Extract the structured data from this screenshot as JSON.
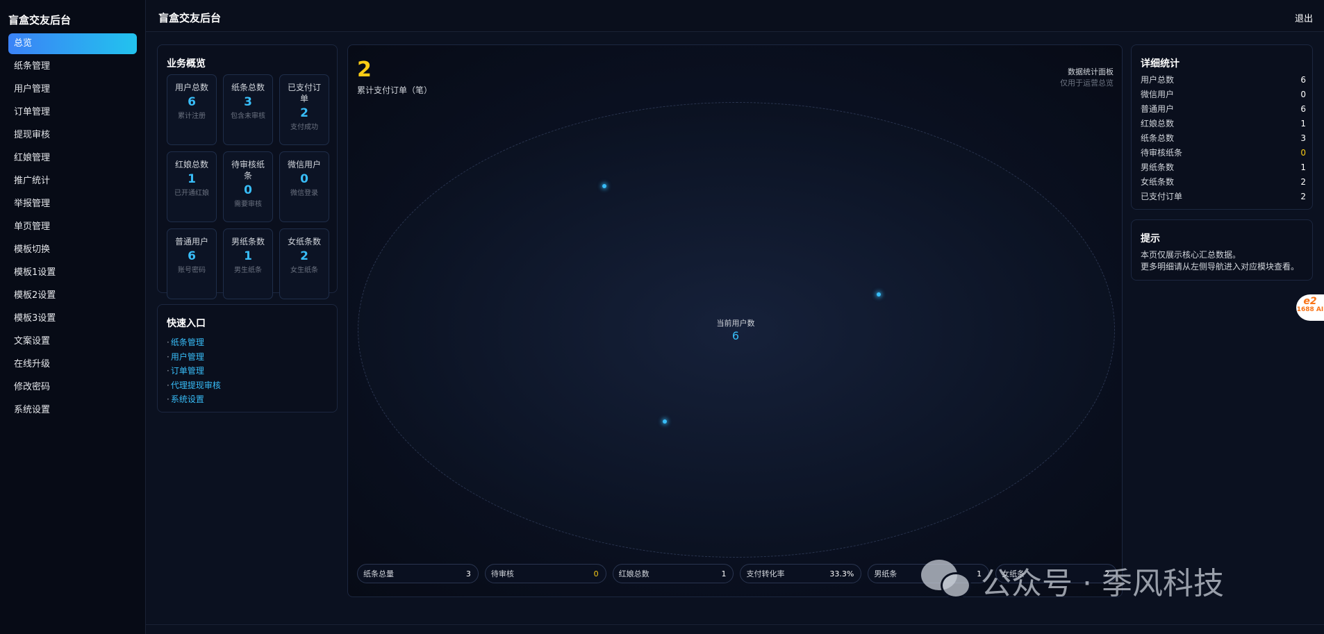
{
  "sidebar": {
    "brand": "盲盒交友后台",
    "items": [
      {
        "label": "总览",
        "active": true
      },
      {
        "label": "纸条管理"
      },
      {
        "label": "用户管理"
      },
      {
        "label": "订单管理"
      },
      {
        "label": "提现审核"
      },
      {
        "label": "红娘管理"
      },
      {
        "label": "推广统计"
      },
      {
        "label": "举报管理"
      },
      {
        "label": "单页管理"
      },
      {
        "label": "模板切换"
      },
      {
        "label": "模板1设置"
      },
      {
        "label": "模板2设置"
      },
      {
        "label": "模板3设置"
      },
      {
        "label": "文案设置"
      },
      {
        "label": "在线升级"
      },
      {
        "label": "修改密码"
      },
      {
        "label": "系统设置"
      }
    ]
  },
  "header": {
    "title": "盲盒交友后台",
    "logout": "退出"
  },
  "overview": {
    "title": "业务概览",
    "stats": [
      {
        "label": "用户总数",
        "value": "6",
        "sub": "累计注册"
      },
      {
        "label": "纸条总数",
        "value": "3",
        "sub": "包含未审核"
      },
      {
        "label": "已支付订单",
        "value": "2",
        "sub": "支付成功"
      },
      {
        "label": "红娘总数",
        "value": "1",
        "sub": "已开通红娘"
      },
      {
        "label": "待审核纸条",
        "value": "0",
        "sub": "需要审核"
      },
      {
        "label": "微信用户",
        "value": "0",
        "sub": "微信登录"
      },
      {
        "label": "普通用户",
        "value": "6",
        "sub": "账号密码"
      },
      {
        "label": "男纸条数",
        "value": "1",
        "sub": "男生纸条"
      },
      {
        "label": "女纸条数",
        "value": "2",
        "sub": "女生纸条"
      }
    ]
  },
  "quick": {
    "title": "快速入口",
    "links": [
      "纸条管理",
      "用户管理",
      "订单管理",
      "代理提现审核",
      "系统设置"
    ]
  },
  "panel": {
    "big_number": "2",
    "big_number_label": "累计支付订单（笔）",
    "title": "数据统计面板",
    "subtitle": "仅用于运营总览",
    "center_label": "当前用户数",
    "center_value": "6",
    "pills": [
      {
        "label": "纸条总量",
        "value": "3"
      },
      {
        "label": "待审核",
        "value": "0",
        "warn": true
      },
      {
        "label": "红娘总数",
        "value": "1"
      },
      {
        "label": "支付转化率",
        "value": "33.3%"
      },
      {
        "label": "男纸条",
        "value": "1"
      },
      {
        "label": "女纸条",
        "value": "2"
      }
    ]
  },
  "detail": {
    "title": "详细统计",
    "rows": [
      {
        "label": "用户总数",
        "value": "6"
      },
      {
        "label": "微信用户",
        "value": "0"
      },
      {
        "label": "普通用户",
        "value": "6"
      },
      {
        "label": "红娘总数",
        "value": "1"
      },
      {
        "label": "纸条总数",
        "value": "3"
      },
      {
        "label": "待审核纸条",
        "value": "0",
        "warn": true
      },
      {
        "label": "男纸条数",
        "value": "1"
      },
      {
        "label": "女纸条数",
        "value": "2"
      },
      {
        "label": "已支付订单",
        "value": "2"
      }
    ]
  },
  "tips": {
    "title": "提示",
    "line1": "本页仅展示核心汇总数据。",
    "line2": "更多明细请从左侧导航进入对应模块查看。"
  },
  "badge": {
    "top": "e2",
    "bottom": "1688 AI"
  },
  "watermark": {
    "text": "公众号 · 季风科技"
  },
  "colors": {
    "accent": "#38bdf8",
    "highlight": "#facc15",
    "active_start": "#3b82f6",
    "active_end": "#22c3ee"
  }
}
